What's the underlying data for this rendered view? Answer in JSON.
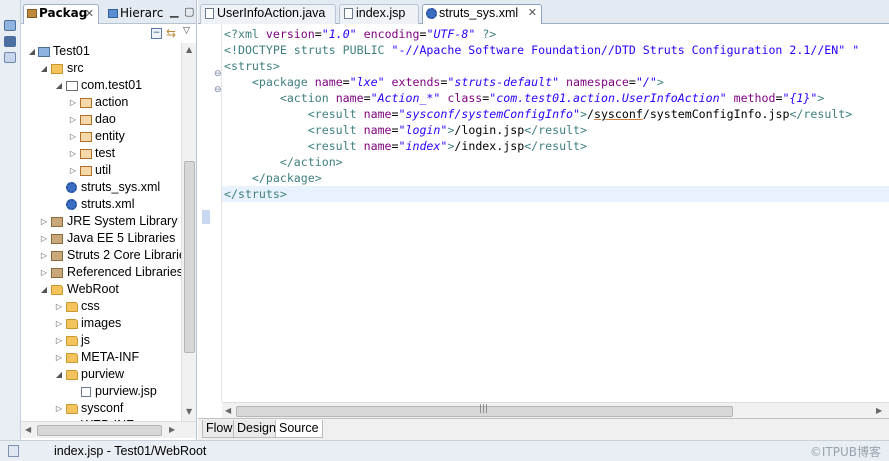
{
  "left_panel": {
    "tabs": [
      {
        "label": "Packag",
        "icon": "package-explorer-icon"
      },
      {
        "label": "Hierarc",
        "icon": "hierarchy-icon"
      }
    ],
    "tree": [
      {
        "label": "Test01",
        "level": 0,
        "twisty": "open",
        "icon": "project-icon"
      },
      {
        "label": "src",
        "level": 1,
        "twisty": "open",
        "icon": "source-folder-icon"
      },
      {
        "label": "com.test01",
        "level": 2,
        "twisty": "open",
        "icon": "package-icon"
      },
      {
        "label": "action",
        "level": 3,
        "twisty": "closed",
        "icon": "package-icon"
      },
      {
        "label": "dao",
        "level": 3,
        "twisty": "closed",
        "icon": "package-icon"
      },
      {
        "label": "entity",
        "level": 3,
        "twisty": "closed",
        "icon": "package-icon"
      },
      {
        "label": "test",
        "level": 3,
        "twisty": "closed",
        "icon": "package-icon"
      },
      {
        "label": "util",
        "level": 3,
        "twisty": "closed",
        "icon": "package-icon"
      },
      {
        "label": "struts_sys.xml",
        "level": 2,
        "twisty": "none",
        "icon": "xml-gear-icon"
      },
      {
        "label": "struts.xml",
        "level": 2,
        "twisty": "none",
        "icon": "xml-gear-icon"
      },
      {
        "label": "JRE System Library [S",
        "level": 1,
        "twisty": "closed",
        "icon": "library-icon"
      },
      {
        "label": "Java EE 5 Libraries",
        "level": 1,
        "twisty": "closed",
        "icon": "library-icon"
      },
      {
        "label": "Struts 2 Core Librarie",
        "level": 1,
        "twisty": "closed",
        "icon": "library-icon"
      },
      {
        "label": "Referenced Libraries",
        "level": 1,
        "twisty": "closed",
        "icon": "library-icon"
      },
      {
        "label": "WebRoot",
        "level": 1,
        "twisty": "open",
        "icon": "folder-icon"
      },
      {
        "label": "css",
        "level": 2,
        "twisty": "closed",
        "icon": "folder-icon"
      },
      {
        "label": "images",
        "level": 2,
        "twisty": "closed",
        "icon": "folder-icon"
      },
      {
        "label": "js",
        "level": 2,
        "twisty": "closed",
        "icon": "folder-icon"
      },
      {
        "label": "META-INF",
        "level": 2,
        "twisty": "closed",
        "icon": "folder-icon"
      },
      {
        "label": "purview",
        "level": 2,
        "twisty": "open",
        "icon": "folder-icon"
      },
      {
        "label": "purview.jsp",
        "level": 3,
        "twisty": "none",
        "icon": "jsp-file-icon"
      },
      {
        "label": "sysconf",
        "level": 2,
        "twisty": "closed",
        "icon": "folder-icon"
      },
      {
        "label": "WEB-INF",
        "level": 2,
        "twisty": "closed",
        "icon": "folder-icon"
      }
    ]
  },
  "editor": {
    "tabs": [
      {
        "label": "UserInfoAction.java",
        "icon": "java-file-icon",
        "active": false
      },
      {
        "label": "index.jsp",
        "icon": "jsp-file-icon",
        "active": false
      },
      {
        "label": "struts_sys.xml",
        "icon": "xml-gear-icon",
        "active": true
      }
    ],
    "code_lines": [
      "<?xml version=\"1.0\" encoding=\"UTF-8\" ?>",
      "<!DOCTYPE struts PUBLIC \"-//Apache Software Foundation//DTD Struts Configuration 2.1//EN\" \"",
      "<struts>",
      "    <package name=\"lxe\" extends=\"struts-default\" namespace=\"/\">",
      "        <action name=\"Action_*\" class=\"com.test01.action.UserInfoAction\" method=\"{1}\">",
      "            <result name=\"sysconf/systemConfigInfo\">/sysconf/systemConfigInfo.jsp</result>",
      "            <result name=\"login\">/login.jsp</result>",
      "            <result name=\"index\">/index.jsp</result>",
      "        </action>",
      "    </package>",
      "</struts>",
      ""
    ],
    "bottom_tabs": [
      {
        "label": "Flow",
        "active": false
      },
      {
        "label": "Design",
        "active": false
      },
      {
        "label": "Source",
        "active": true
      }
    ]
  },
  "status_bar": {
    "text": "index.jsp - Test01/WebRoot"
  },
  "watermark": "©ITPUB博客",
  "colors": {
    "xml_tag": "#3f7f7f",
    "xml_attr": "#7f007f",
    "xml_value": "#2a00ff",
    "tab_bar": "#e4eaf2",
    "current_line": "#e8f2fe"
  }
}
